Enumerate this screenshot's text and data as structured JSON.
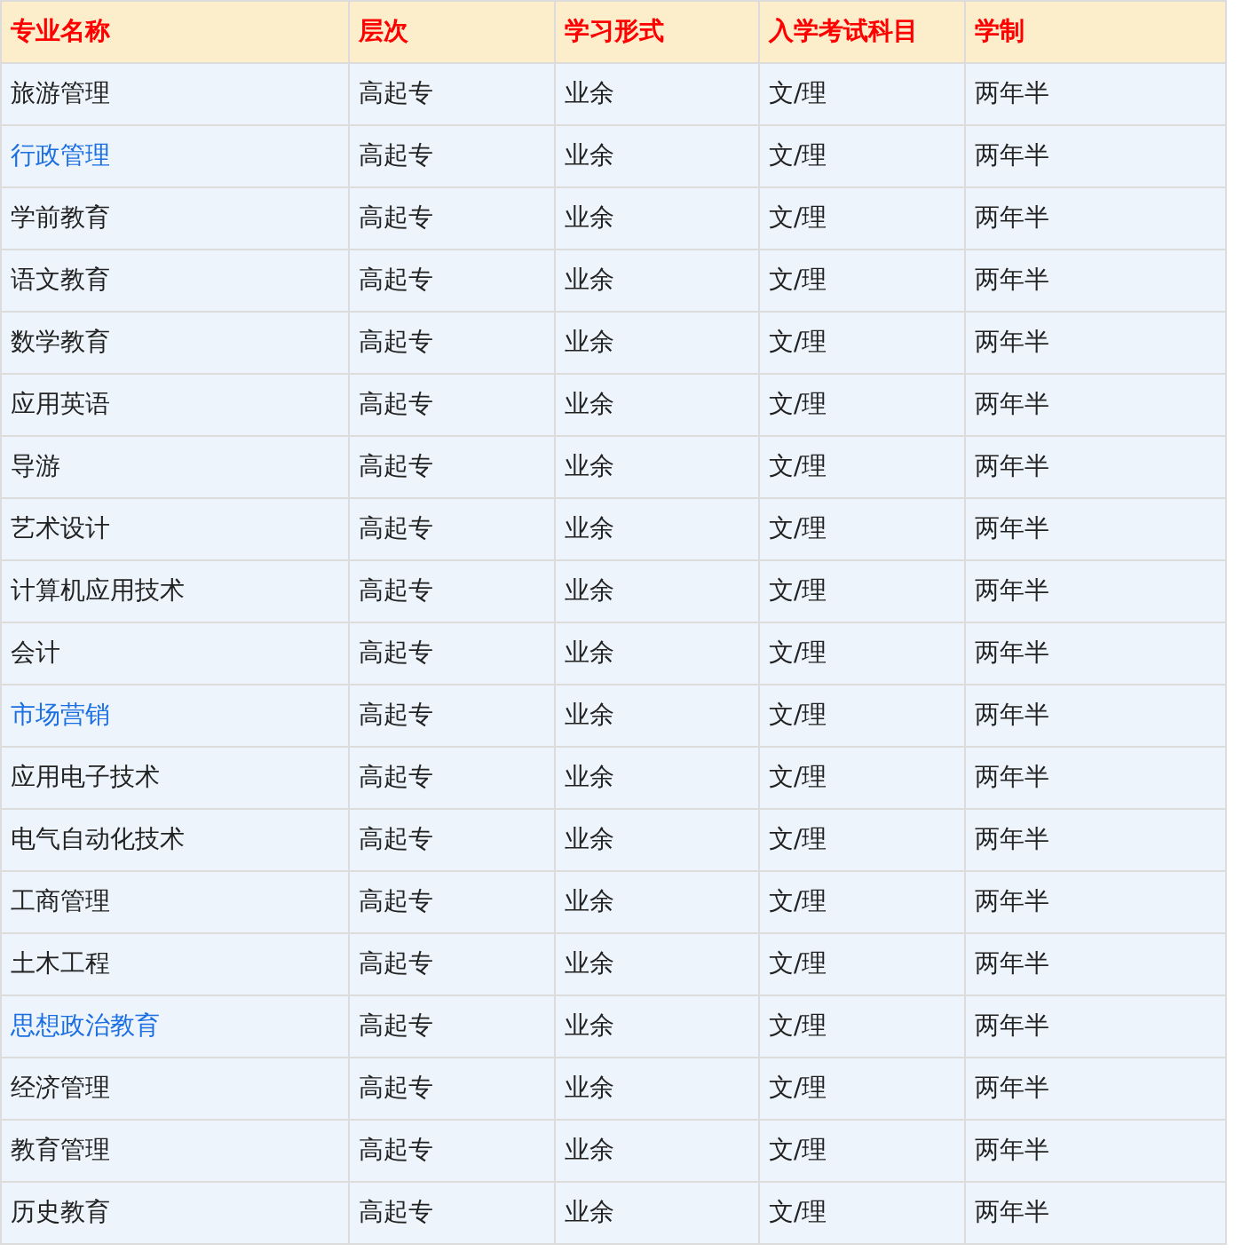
{
  "table": {
    "columns": [
      "专业名称",
      "层次",
      "学习形式",
      "入学考试科目",
      "学制"
    ],
    "rows": [
      {
        "kind": "text",
        "cells": [
          "旅游管理",
          "高起专",
          "业余",
          "文/理",
          "两年半"
        ]
      },
      {
        "kind": "link",
        "cells": [
          "行政管理",
          "高起专",
          "业余",
          "文/理",
          "两年半"
        ]
      },
      {
        "kind": "text",
        "cells": [
          "学前教育",
          "高起专",
          "业余",
          "文/理",
          "两年半"
        ]
      },
      {
        "kind": "text",
        "cells": [
          "语文教育",
          "高起专",
          "业余",
          "文/理",
          "两年半"
        ]
      },
      {
        "kind": "text",
        "cells": [
          "数学教育",
          "高起专",
          "业余",
          "文/理",
          "两年半"
        ]
      },
      {
        "kind": "text",
        "cells": [
          "应用英语",
          "高起专",
          "业余",
          "文/理",
          "两年半"
        ]
      },
      {
        "kind": "text",
        "cells": [
          "导游",
          "高起专",
          "业余",
          "文/理",
          "两年半"
        ]
      },
      {
        "kind": "text",
        "cells": [
          "艺术设计",
          "高起专",
          "业余",
          "文/理",
          "两年半"
        ]
      },
      {
        "kind": "text",
        "cells": [
          "计算机应用技术",
          "高起专",
          "业余",
          "文/理",
          "两年半"
        ]
      },
      {
        "kind": "text",
        "cells": [
          "会计",
          "高起专",
          "业余",
          "文/理",
          "两年半"
        ]
      },
      {
        "kind": "link",
        "cells": [
          "市场营销",
          "高起专",
          "业余",
          "文/理",
          "两年半"
        ]
      },
      {
        "kind": "text",
        "cells": [
          "应用电子技术",
          "高起专",
          "业余",
          "文/理",
          "两年半"
        ]
      },
      {
        "kind": "text",
        "cells": [
          "电气自动化技术",
          "高起专",
          "业余",
          "文/理",
          "两年半"
        ]
      },
      {
        "kind": "text",
        "cells": [
          "工商管理",
          "高起专",
          "业余",
          "文/理",
          "两年半"
        ]
      },
      {
        "kind": "text",
        "cells": [
          "土木工程",
          "高起专",
          "业余",
          "文/理",
          "两年半"
        ]
      },
      {
        "kind": "link",
        "cells": [
          "思想政治教育",
          "高起专",
          "业余",
          "文/理",
          "两年半"
        ]
      },
      {
        "kind": "text",
        "cells": [
          "经济管理",
          "高起专",
          "业余",
          "文/理",
          "两年半"
        ]
      },
      {
        "kind": "text",
        "cells": [
          "教育管理",
          "高起专",
          "业余",
          "文/理",
          "两年半"
        ]
      },
      {
        "kind": "text",
        "cells": [
          "历史教育",
          "高起专",
          "业余",
          "文/理",
          "两年半"
        ]
      }
    ]
  }
}
